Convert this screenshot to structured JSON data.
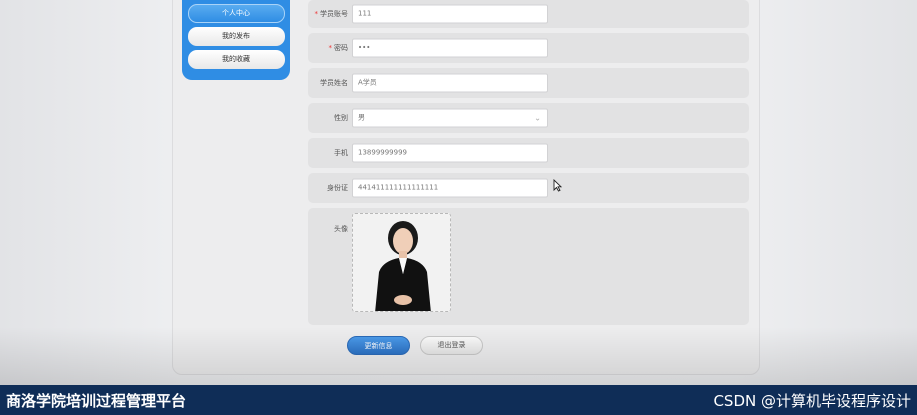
{
  "sidebar": {
    "items": [
      {
        "label": "个人中心",
        "active": true
      },
      {
        "label": "我的发布",
        "active": false
      },
      {
        "label": "我的收藏",
        "active": false
      }
    ]
  },
  "form": {
    "fields": {
      "account": {
        "label": "学员账号",
        "value": "111",
        "required": true
      },
      "password": {
        "label": "密码",
        "value": "•••",
        "required": true
      },
      "name": {
        "label": "学员姓名",
        "value": "A学员",
        "required": false
      },
      "gender": {
        "label": "性别",
        "value": "男",
        "required": false
      },
      "phone": {
        "label": "手机",
        "value": "13899999999",
        "required": false
      },
      "idcard": {
        "label": "身份证",
        "value": "441411111111111111",
        "required": false
      },
      "avatar": {
        "label": "头像"
      }
    },
    "actions": {
      "update_label": "更新信息",
      "logout_label": "退出登录"
    }
  },
  "caption": {
    "left": "商洛学院培训过程管理平台",
    "right": "CSDN @计算机毕设程序设计"
  },
  "colors": {
    "accent": "#2f8de4",
    "caption_bar": "#0f2d57",
    "required_star": "#ee3333"
  }
}
